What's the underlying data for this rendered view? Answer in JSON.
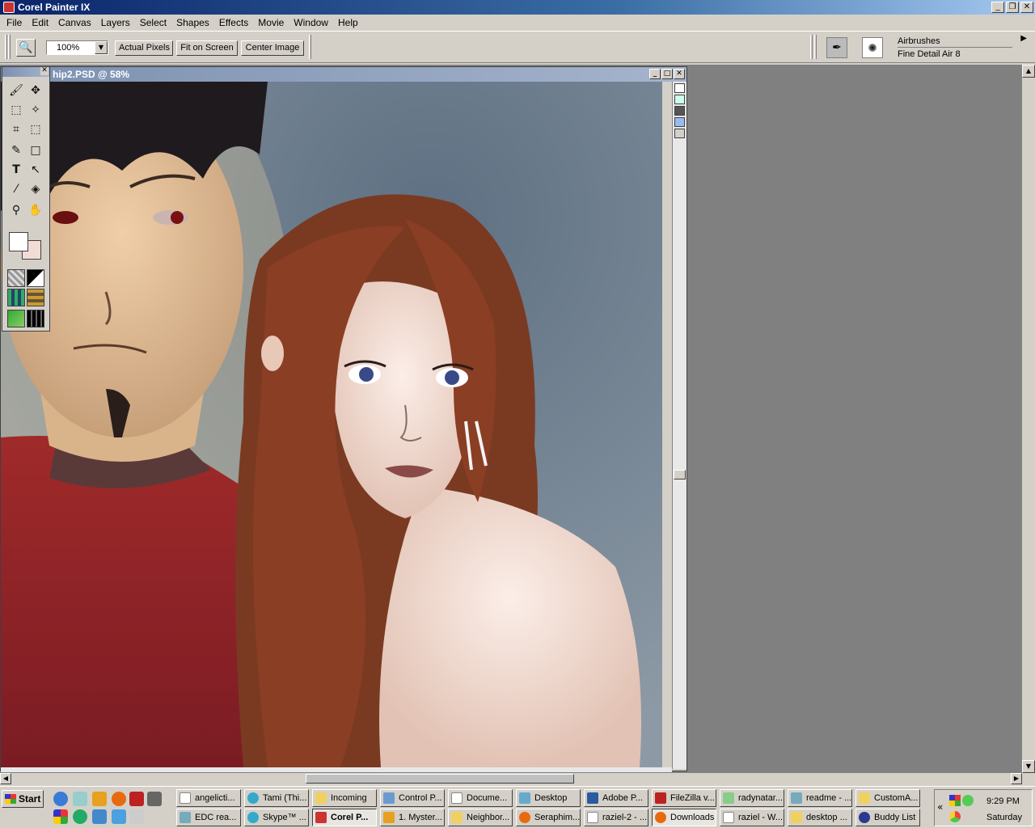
{
  "window": {
    "title": "Corel Painter IX"
  },
  "menu": [
    "File",
    "Edit",
    "Canvas",
    "Layers",
    "Select",
    "Shapes",
    "Effects",
    "Movie",
    "Window",
    "Help"
  ],
  "toolbar": {
    "zoom_value": "100%",
    "actual_pixels": "Actual Pixels",
    "fit_on_screen": "Fit on Screen",
    "center_image": "Center Image",
    "brush_category": "Airbrushes",
    "brush_variant": "Fine Detail Air 8"
  },
  "document": {
    "title": "hip2.PSD @ 58%"
  },
  "toolbox": {
    "tools": [
      "brush-icon",
      "move-icon",
      "rect-select-icon",
      "magic-wand-icon",
      "crop-icon",
      "lasso-icon",
      "pen-icon",
      "rectangle-icon",
      "text-icon",
      "arrow-icon",
      "dropper-icon",
      "bucket-icon",
      "magnifier-icon",
      "hand-icon"
    ],
    "main_color": "#ffffff",
    "additional_color": "#f2dcd6"
  },
  "taskbar": {
    "start": "Start",
    "row1": [
      "angelicti...",
      "Tami (Thi...",
      "Incoming",
      "Control P...",
      "Docume...",
      "Desktop",
      "Adobe P...",
      "FileZilla v...",
      "radynatar...",
      "readme - ...",
      "CustomA..."
    ],
    "row2": [
      "EDC rea...",
      "Skype™ ...",
      "Corel P...",
      "1. Myster...",
      "Neighbor...",
      "Seraphim...",
      "raziel-2 - ...",
      "Downloads",
      "raziel - W...",
      "desktop ...",
      "Buddy List"
    ],
    "clock": "9:29 PM",
    "day": "Saturday"
  }
}
